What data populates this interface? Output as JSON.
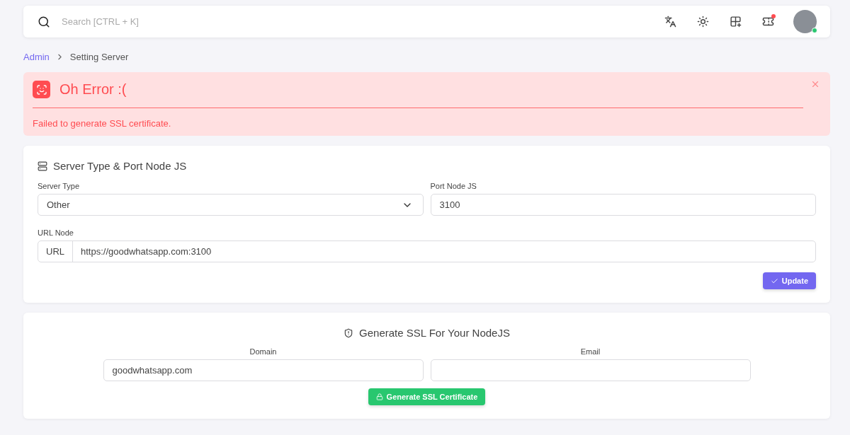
{
  "topbar": {
    "search": {
      "placeholder": "Search [CTRL + K]"
    },
    "notification_unread": true,
    "user_online": true
  },
  "breadcrumb": [
    "Admin",
    "Setting Server"
  ],
  "alert": {
    "title": "Oh Error :(",
    "message": "Failed to generate SSL certificate."
  },
  "server_card": {
    "title": "Server Type & Port Node JS",
    "server_type": {
      "label": "Server Type",
      "value": "Other"
    },
    "port": {
      "label": "Port Node JS",
      "value": "3100"
    },
    "url": {
      "label": "URL Node",
      "prefix": "URL",
      "value": "https://goodwhatsapp.com:3100"
    },
    "button": "Update"
  },
  "ssl_card": {
    "title": "Generate SSL For Your NodeJS",
    "domain": {
      "label": "Domain",
      "value": "goodwhatsapp.com"
    },
    "email": {
      "label": "Email"
    },
    "button": "Generate SSL Certificate"
  }
}
